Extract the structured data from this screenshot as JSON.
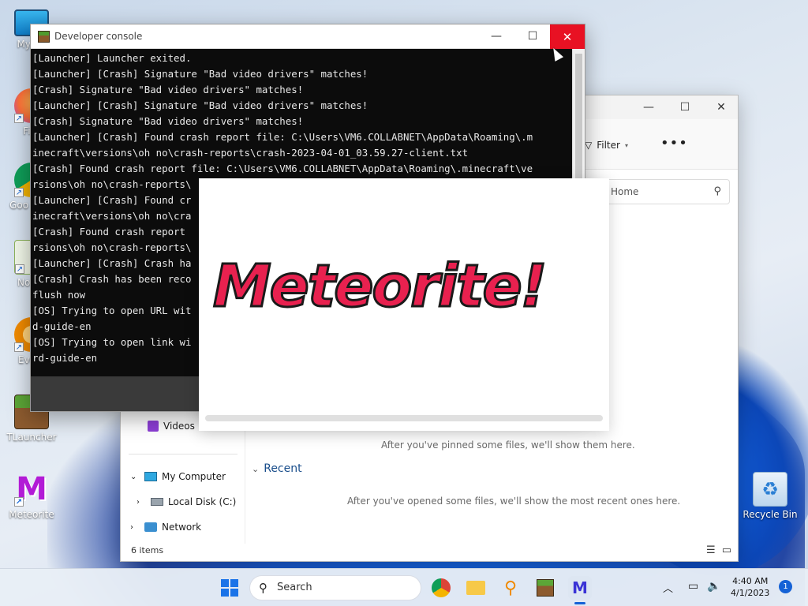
{
  "desktop": {
    "icons": [
      {
        "label": "My Co",
        "glyph": "🖥"
      },
      {
        "label": "Fire",
        "glyph": "🦊"
      },
      {
        "label": "Goo Chro",
        "glyph": "◉"
      },
      {
        "label": "Notep",
        "glyph": "📝"
      },
      {
        "label": "Every",
        "glyph": "🔍"
      },
      {
        "label": "TLauncher",
        "glyph": "▩"
      },
      {
        "label": "Meteorite",
        "glyph": "M"
      },
      {
        "label": "Recycle Bin",
        "glyph": "♻"
      }
    ]
  },
  "explorer": {
    "toolbar": {
      "filter_label": "Filter",
      "more_label": "•••"
    },
    "search_placeholder": "Home",
    "nav": {
      "videos": "Videos",
      "my_computer": "My Computer",
      "local_disk": "Local Disk (C:)",
      "network": "Network"
    },
    "content": {
      "pinned_empty": "After you've pinned some files, we'll show them here.",
      "recent_heading": "Recent",
      "recent_empty": "After you've opened some files, we'll show the most recent ones here."
    },
    "status": {
      "item_count": "6 items"
    }
  },
  "dev_console": {
    "title": "Developer console",
    "lines": [
      "[Launcher] Launcher exited.",
      "[Launcher] [Crash] Signature \"Bad video drivers\" matches!",
      "[Crash] Signature \"Bad video drivers\" matches!",
      "[Launcher] [Crash] Signature \"Bad video drivers\" matches!",
      "[Crash] Signature \"Bad video drivers\" matches!",
      "[Launcher] [Crash] Found crash report file: C:\\Users\\VM6.COLLABNET\\AppData\\Roaming\\.m",
      "inecraft\\versions\\oh no\\crash-reports\\crash-2023-04-01_03.59.27-client.txt",
      "[Crash] Found crash report file: C:\\Users\\VM6.COLLABNET\\AppData\\Roaming\\.minecraft\\ve",
      "rsions\\oh no\\crash-reports\\",
      "[Launcher] [Crash] Found cr",
      "inecraft\\versions\\oh no\\cra",
      "[Crash] Found crash report ",
      "rsions\\oh no\\crash-reports\\",
      "[Launcher] [Crash] Crash ha",
      "[Crash] Crash has been reco",
      "flush now",
      "[OS] Trying to open URL wit",
      "d-guide-en",
      "[OS] Trying to open link wi",
      "rd-guide-en"
    ]
  },
  "splash": {
    "logo_text": "Meteorite!"
  },
  "taskbar": {
    "search_label": "Search",
    "time": "4:40 AM",
    "date": "4/1/2023",
    "notification_count": "1"
  },
  "colors": {
    "close_red": "#e81123",
    "logo_red": "#e8214f",
    "accent_blue": "#1562d6"
  }
}
